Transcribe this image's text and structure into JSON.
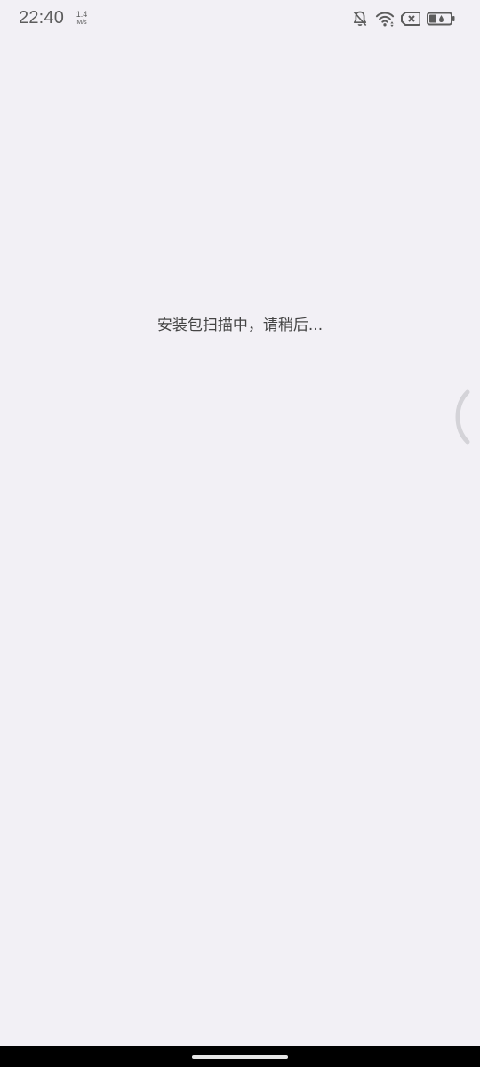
{
  "status_bar": {
    "time": "22:40",
    "net_speed_value": "1.4",
    "net_speed_unit": "M/s",
    "icons": [
      "bell-off-icon",
      "wifi-icon",
      "sim-x-icon",
      "battery-saver-icon"
    ]
  },
  "main": {
    "loading_text": "安装包扫描中，请稍后..."
  },
  "colors": {
    "background": "#f2f0f5",
    "text": "#444444",
    "status_icon": "#5c5c5c",
    "nav_bar": "#000000"
  }
}
